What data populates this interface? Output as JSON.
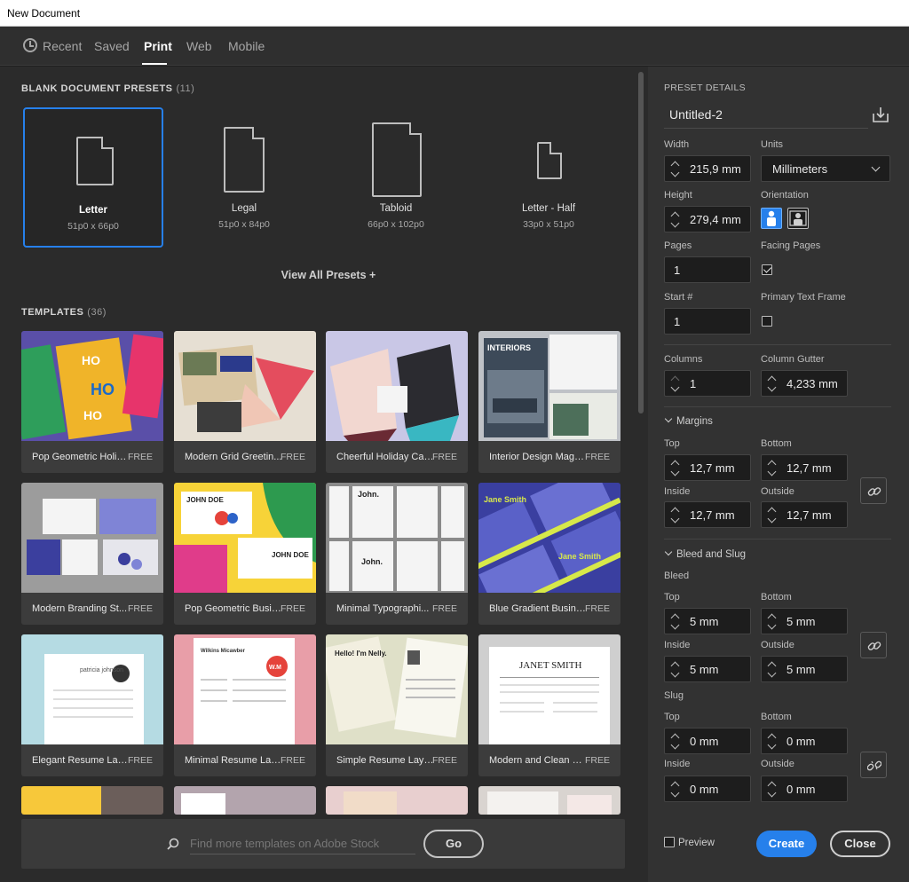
{
  "window": {
    "title": "New Document"
  },
  "tabs": [
    {
      "label": "Recent"
    },
    {
      "label": "Saved"
    },
    {
      "label": "Print"
    },
    {
      "label": "Web"
    },
    {
      "label": "Mobile"
    }
  ],
  "presets": {
    "heading": "BLANK DOCUMENT PRESETS",
    "count": "(11)",
    "items": [
      {
        "name": "Letter",
        "size": "51p0 x 66p0"
      },
      {
        "name": "Legal",
        "size": "51p0 x 84p0"
      },
      {
        "name": "Tabloid",
        "size": "66p0 x 102p0"
      },
      {
        "name": "Letter - Half",
        "size": "33p0 x 51p0"
      }
    ],
    "view_all": "View All Presets +"
  },
  "templates": {
    "heading": "TEMPLATES",
    "count": "(36)",
    "items": [
      {
        "name": "Pop Geometric Holid...",
        "badge": "FREE"
      },
      {
        "name": "Modern Grid Greetin...",
        "badge": "FREE"
      },
      {
        "name": "Cheerful Holiday Car...",
        "badge": "FREE"
      },
      {
        "name": "Interior Design Maga...",
        "badge": "FREE"
      },
      {
        "name": "Modern Branding St...",
        "badge": "FREE"
      },
      {
        "name": "Pop Geometric Busin...",
        "badge": "FREE"
      },
      {
        "name": "Minimal Typographi...",
        "badge": "FREE"
      },
      {
        "name": "Blue Gradient Busine...",
        "badge": "FREE"
      },
      {
        "name": "Elegant Resume Lay...",
        "badge": "FREE"
      },
      {
        "name": "Minimal Resume Lay...",
        "badge": "FREE"
      },
      {
        "name": "Simple Resume Layout",
        "badge": "FREE"
      },
      {
        "name": "Modern and Clean R...",
        "badge": "FREE"
      }
    ],
    "thumb_text": {
      "ho": "HO",
      "interiors": "INTERIORS",
      "john_doe": "JOHN DOE",
      "john": "John.",
      "jane": "Jane Smith",
      "patricia": "patricia johnson",
      "wm": "W.M",
      "wilkins": "Wilkins Micawber",
      "nelly": "Hello! I'm Nelly.",
      "janet": "JANET SMITH"
    }
  },
  "search": {
    "placeholder": "Find more templates on Adobe Stock",
    "go_label": "Go"
  },
  "details": {
    "heading": "PRESET DETAILS",
    "doc_name": "Untitled-2",
    "width_label": "Width",
    "width": "215,9 mm",
    "units_label": "Units",
    "units": "Millimeters",
    "height_label": "Height",
    "height": "279,4 mm",
    "orientation_label": "Orientation",
    "pages_label": "Pages",
    "pages": "1",
    "facing_label": "Facing Pages",
    "start_label": "Start #",
    "start": "1",
    "primary_label": "Primary Text Frame",
    "columns_label": "Columns",
    "columns": "1",
    "gutter_label": "Column Gutter",
    "gutter": "4,233 mm",
    "margins": {
      "heading": "Margins",
      "top_label": "Top",
      "top": "12,7 mm",
      "bottom_label": "Bottom",
      "bottom": "12,7 mm",
      "inside_label": "Inside",
      "inside": "12,7 mm",
      "outside_label": "Outside",
      "outside": "12,7 mm"
    },
    "bleed_slug": {
      "heading": "Bleed and Slug",
      "bleed_label": "Bleed",
      "bleed_top_label": "Top",
      "bleed_top": "5 mm",
      "bleed_bottom_label": "Bottom",
      "bleed_bottom": "5 mm",
      "bleed_inside_label": "Inside",
      "bleed_inside": "5 mm",
      "bleed_outside_label": "Outside",
      "bleed_outside": "5 mm",
      "slug_label": "Slug",
      "slug_top_label": "Top",
      "slug_top": "0 mm",
      "slug_bottom_label": "Bottom",
      "slug_bottom": "0 mm",
      "slug_inside_label": "Inside",
      "slug_inside": "0 mm",
      "slug_outside_label": "Outside",
      "slug_outside": "0 mm"
    }
  },
  "footer": {
    "preview_label": "Preview",
    "create_label": "Create",
    "close_label": "Close"
  },
  "colors": {
    "accent": "#2680eb",
    "panel": "#323232",
    "background": "#2b2b2b"
  }
}
